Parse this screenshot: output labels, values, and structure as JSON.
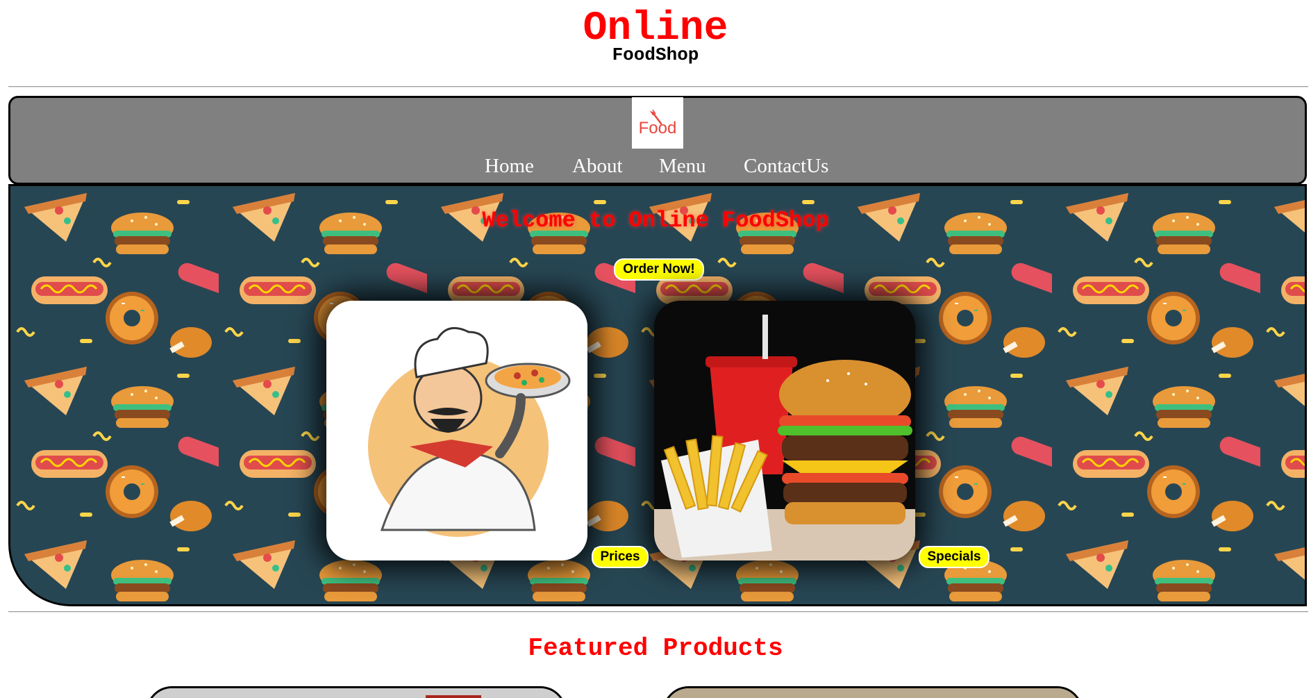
{
  "header": {
    "title": "Online",
    "subtitle": "FoodShop"
  },
  "nav": {
    "logo_text": "Food",
    "items": [
      {
        "label": "Home"
      },
      {
        "label": "About"
      },
      {
        "label": "Menu"
      },
      {
        "label": "ContactUs"
      }
    ]
  },
  "hero": {
    "title": "Welcome to Online FoodShop",
    "order_button": "Order Now!",
    "cards": [
      {
        "image": "chef-with-pizza-illustration",
        "button": "Prices"
      },
      {
        "image": "burger-fries-drink-photo",
        "button": "Specials"
      }
    ]
  },
  "featured": {
    "title": "Featured Products"
  },
  "colors": {
    "accent_red": "#ff0000",
    "pill_yellow": "#ffff00",
    "nav_gray": "#808080",
    "pattern_bg": "#274653"
  }
}
